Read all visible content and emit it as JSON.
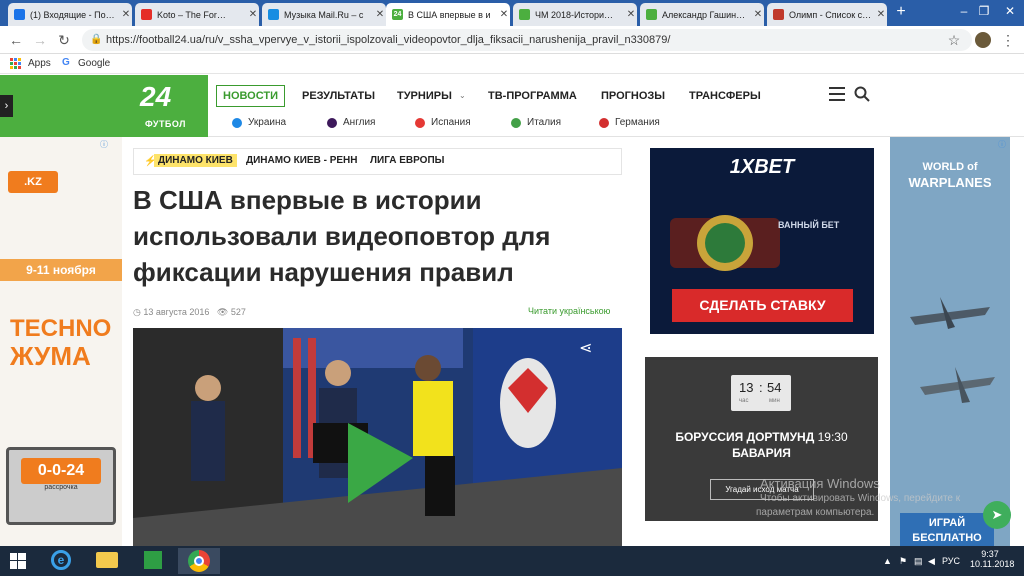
{
  "browser": {
    "tabs": [
      {
        "title": "(1) Входящие - По…",
        "favicon_color": "#1a73e8"
      },
      {
        "title": "Koto – The For…",
        "favicon_color": "#e52d27"
      },
      {
        "title": "Музыка Mail.Ru – с",
        "favicon_color": "#168de2"
      },
      {
        "title": "В США впервые в и",
        "favicon_color": "#4caf3f",
        "active": true
      },
      {
        "title": "ЧМ 2018-Истори…",
        "favicon_color": "#4caf3f"
      },
      {
        "title": "Александр Гашин…",
        "favicon_color": "#4caf3f"
      },
      {
        "title": "Олимп - Список с…",
        "favicon_color": "#c0392b"
      }
    ],
    "active_tab_favicon_text": "24",
    "url": "https://football24.ua/ru/v_ssha_vpervye_v_istorii_ispolzovali_videopovtor_dlja_fiksacii_narushenija_pravil_n330879/",
    "bookmarks": {
      "apps": "Apps",
      "google": "Google"
    }
  },
  "site": {
    "logo_number": "24",
    "logo_text": "ФУТБОЛ",
    "nav": [
      "НОВОСТИ",
      "РЕЗУЛЬТАТЫ",
      "ТУРНИРЫ",
      "ТВ-ПРОГРАММА",
      "ПРОГНОЗЫ",
      "ТРАНСФЕРЫ"
    ],
    "subnav": [
      {
        "label": "Украина",
        "color": "#1e88e5"
      },
      {
        "label": "Англия",
        "color": "#3d195b"
      },
      {
        "label": "Испания",
        "color": "#e53935"
      },
      {
        "label": "Италия",
        "color": "#43a047"
      },
      {
        "label": "Германия",
        "color": "#d32f2f"
      }
    ]
  },
  "article": {
    "tags": [
      "ДИНАМО КИЕВ",
      "ДИНАМО КИЕВ - РЕНН",
      "ЛИГА ЕВРОПЫ"
    ],
    "headline": "В США впервые в истории использовали видеоповтор для фиксации нарушения правил",
    "date": "13 августа 2016",
    "views": "527",
    "ukr_link": "Читати українською"
  },
  "ads": {
    "left": {
      "brand": ".KZ",
      "date_text": "9-11 ноября",
      "title_line1": "TECHNO",
      "title_line2": "ЖУМА",
      "price": "0-0-24",
      "price_sub": "рассрочка"
    },
    "bet": {
      "brand": "1XBET",
      "button": "СДЕЛАТЬ СТАВКУ",
      "overlay": "ВАННЫЙ БЕТ"
    },
    "right": {
      "brand_line1": "WORLD of",
      "brand_line2": "WARPLANES",
      "button_line1": "ИГРАЙ",
      "button_line2": "БЕСПЛАТНО"
    }
  },
  "match": {
    "hours": "13",
    "minutes": "54",
    "hours_label": "час",
    "minutes_label": "мин",
    "team1": "БОРУССИЯ ДОРТМУНД",
    "time": "19:30",
    "team2": "БАВАРИЯ",
    "button": "Угадай исход матча"
  },
  "watermark": {
    "line1": "Активация Windows",
    "line2": "Чтобы активировать Windows, перейдите к",
    "line3": "параметрам компьютера."
  },
  "taskbar": {
    "lang": "РУС",
    "time": "9:37",
    "date": "10.11.2018"
  }
}
